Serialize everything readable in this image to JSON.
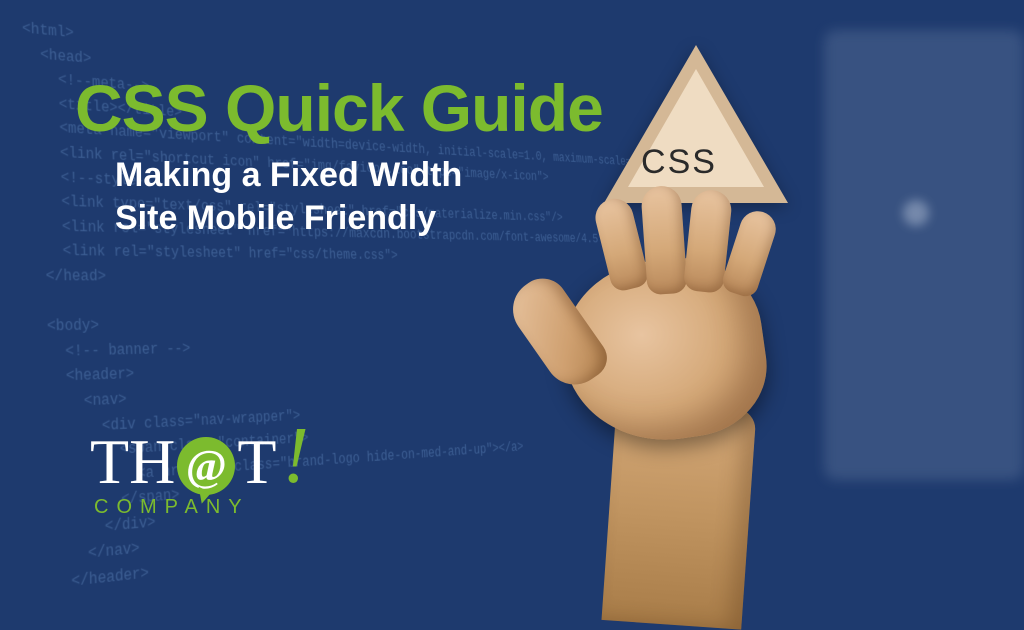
{
  "title": "CSS Quick Guide",
  "subtitle_line1": "Making a Fixed Width",
  "subtitle_line2": "Site Mobile Friendly",
  "triangle_label": "CSS",
  "logo": {
    "part1": "TH",
    "at": "@",
    "part2": "T",
    "excl": "!",
    "sub": "COMPANY"
  },
  "code_lines": [
    "<html>",
    "  <head>",
    "    <!--meta-->",
    "    <title></title>",
    "    <meta name=\"viewport\" content=\"width=device-width, initial-scale=1.0, maximum-scale=1",
    "    <link rel=\"shortcut icon\" href=\"img/favicon.ico\" type=\"image/x-icon\">",
    "    <!--style-->",
    "    <link type=\"text/css\" rel=\"stylesheet\" href=\"css/materialize.min.css\"/>",
    "    <link rel=\"stylesheet\" href=\"https://maxcdn.bootstrapcdn.com/font-awesome/4.5",
    "    <link rel=\"stylesheet\" href=\"css/theme.css\">",
    "  </head>",
    "",
    "  <body>",
    "    <!-- banner -->",
    "    <header>",
    "      <nav>",
    "        <div class=\"nav-wrapper\">",
    "          <span class=\"container\">",
    "            <a href=\"#\" class=\"brand-logo hide-on-med-and-up\"></a>",
    "          </span>",
    "        </div>",
    "      </nav>",
    "    </header>"
  ]
}
